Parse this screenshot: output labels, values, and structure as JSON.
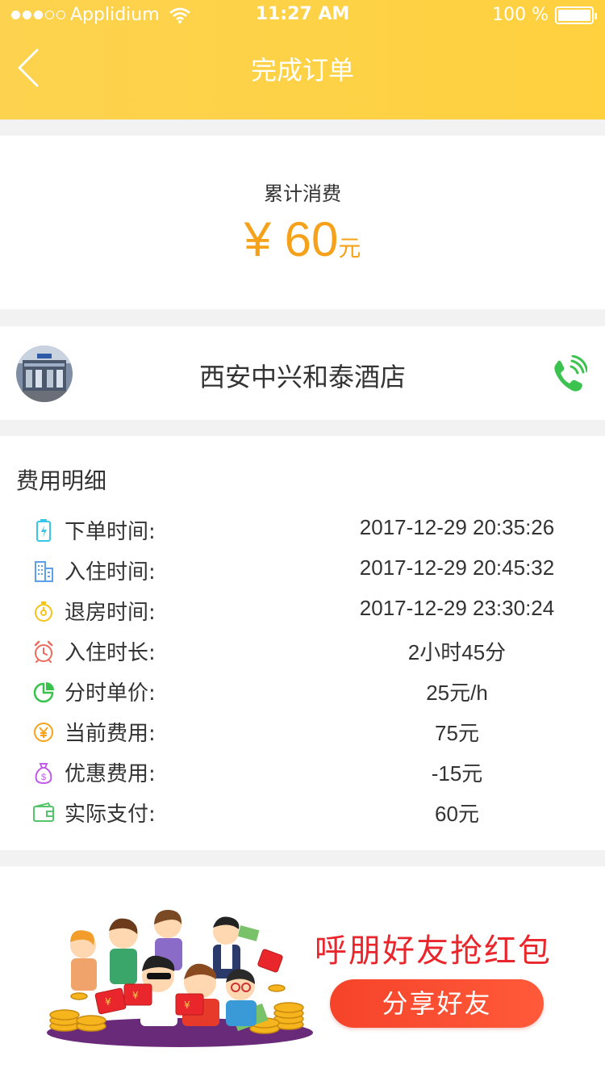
{
  "status_bar": {
    "carrier": "Applidium",
    "time": "11:27 AM",
    "battery": "100 %"
  },
  "nav": {
    "title": "完成订单"
  },
  "total": {
    "label": "累计消费",
    "amount": "¥ 60",
    "unit": "元"
  },
  "hotel": {
    "name": "西安中兴和泰酒店"
  },
  "details": {
    "title": "费用明细",
    "rows": [
      {
        "label": "下单时间:",
        "value": "2017-12-29 20:35:26",
        "icon": "battery-bolt-icon",
        "color": "#3ac6e6"
      },
      {
        "label": "入住时间:",
        "value": "2017-12-29 20:45:32",
        "icon": "building-icon",
        "color": "#5aa0ec"
      },
      {
        "label": "退房时间:",
        "value": "2017-12-29 23:30:24",
        "icon": "timer-icon",
        "color": "#f5c21c"
      },
      {
        "label": "入住时长:",
        "value": "2小时45分",
        "icon": "alarm-clock-icon",
        "color": "#ef6a5e"
      },
      {
        "label": "分时单价:",
        "value": "25元/h",
        "icon": "pie-chart-icon",
        "color": "#37c24a"
      },
      {
        "label": "当前费用:",
        "value": "75元",
        "icon": "yen-coin-icon",
        "color": "#f5a21a"
      },
      {
        "label": "优惠费用:",
        "value": "-15元",
        "icon": "money-bag-icon",
        "color": "#c05ce8"
      },
      {
        "label": "实际支付:",
        "value": "60元",
        "icon": "wallet-icon",
        "color": "#56c46a"
      }
    ]
  },
  "promo": {
    "title": "呼朋好友抢红包",
    "button": "分享好友"
  },
  "colors": {
    "header": "#ffd13f",
    "accent": "#f5a21a",
    "promo_red": "#e8262b",
    "button": "#f6432a"
  }
}
